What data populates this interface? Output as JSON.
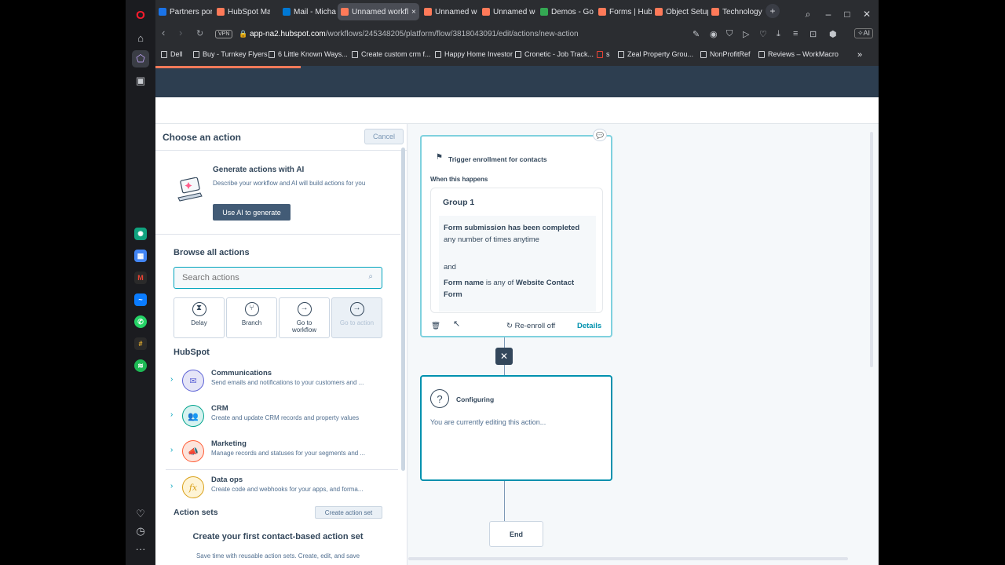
{
  "browser": {
    "tabs": [
      {
        "label": "Partners porta",
        "color": "#1a73e8"
      },
      {
        "label": "HubSpot Mar",
        "color": "#ff7a59"
      },
      {
        "label": "Mail - Michae",
        "color": "#0078d4"
      },
      {
        "label": "Unnamed workflow",
        "color": "#ff7a59"
      },
      {
        "label": "Unnamed wor",
        "color": "#ff7a59"
      },
      {
        "label": "Unnamed wo",
        "color": "#ff7a59"
      },
      {
        "label": "Demos - Goo",
        "color": "#34a853"
      },
      {
        "label": "Forms | HubS",
        "color": "#ff7a59"
      },
      {
        "label": "Object Setup",
        "color": "#ff7a59"
      },
      {
        "label": "Technology P",
        "color": "#ff7a59"
      }
    ],
    "vpn": "VPN",
    "url_host": "app-na2.hubspot.com",
    "url_path": "/workflows/245348205/platform/flow/3818043091/edit/actions/new-action",
    "ai_label": "AI",
    "bookmarks": [
      "Dell",
      "Buy - Turnkey Flyers",
      "6 Little Known Ways...",
      "Create custom crm f...",
      "Happy Home Investor",
      "Cronetic - Job Track...",
      "s",
      "Zeal Property Grou...",
      "NonProfitRef",
      "Reviews – WorkMacro"
    ]
  },
  "panel": {
    "title": "Choose an action",
    "cancel": "Cancel",
    "ai": {
      "title": "Generate actions with AI",
      "desc": "Describe your workflow and AI will build actions for you",
      "button": "Use AI to generate"
    },
    "browse_title": "Browse all actions",
    "search_placeholder": "Search actions",
    "tiles": [
      {
        "label": "Delay",
        "icon": "hourglass-icon",
        "glyph": "⧗"
      },
      {
        "label": "Branch",
        "icon": "branch-icon",
        "glyph": "⑂"
      },
      {
        "label": "Go to workflow",
        "icon": "arrow-right-circle-icon",
        "glyph": "→"
      },
      {
        "label": "Go to action",
        "icon": "arrow-right-circle-icon",
        "glyph": "→"
      }
    ],
    "hubspot_title": "HubSpot",
    "categories": [
      {
        "title": "Communications",
        "desc": "Send emails and notifications to your customers and ...",
        "icon": "envelope-icon",
        "glyph": "✉",
        "bg": "#e5e5f7",
        "fg": "#5c62d6"
      },
      {
        "title": "CRM",
        "desc": "Create and update CRM records and property values",
        "icon": "people-icon",
        "glyph": "👥",
        "bg": "#d6f2ef",
        "fg": "#00a38d"
      },
      {
        "title": "Marketing",
        "desc": "Manage records and statuses for your segments and ...",
        "icon": "megaphone-icon",
        "glyph": "📣",
        "bg": "#fde3db",
        "fg": "#ff5c35"
      },
      {
        "title": "Data ops",
        "desc": "Create code and webhooks for your apps, and forma...",
        "icon": "function-icon",
        "glyph": "fx",
        "bg": "#fef4d6",
        "fg": "#d9a018"
      }
    ],
    "action_sets_title": "Action sets",
    "create_set_button": "Create action set",
    "first_set_title": "Create your first contact-based action set",
    "first_set_desc": "Save time with reusable action sets. Create, edit, and save"
  },
  "canvas": {
    "trigger_title": "Trigger enrollment for contacts",
    "when": "When this happens",
    "group_title": "Group 1",
    "cond1_b1": "Form submission has been completed",
    "cond1_rest": " any number of times anytime",
    "and": "and",
    "cond2_b1": "Form name",
    "cond2_mid": " is any of ",
    "cond2_b2": "Website Contact Form",
    "reenroll": "Re-enroll off",
    "details": "Details",
    "configuring_title": "Configuring",
    "configuring_desc": "You are currently editing this action...",
    "end": "End"
  }
}
